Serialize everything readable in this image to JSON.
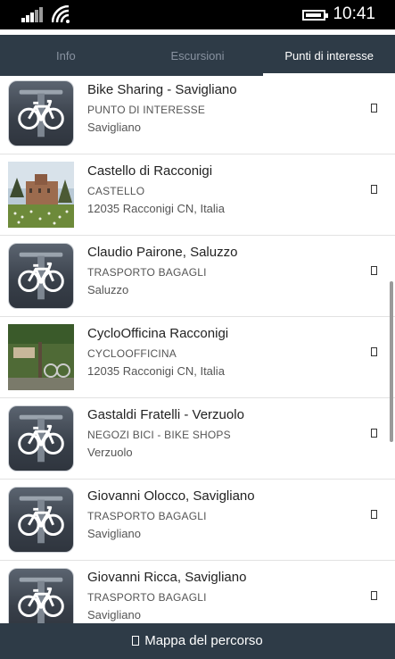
{
  "status": {
    "time": "10:41"
  },
  "tabs": [
    {
      "label": "Info"
    },
    {
      "label": "Escursioni"
    },
    {
      "label": "Punti di interesse"
    }
  ],
  "items": [
    {
      "title": "Bike Sharing - Savigliano",
      "category": "PUNTO DI INTERESSE",
      "location": "Savigliano",
      "thumb": "bike-icon"
    },
    {
      "title": "Castello di Racconigi",
      "category": "CASTELLO",
      "location": "12035 Racconigi CN, Italia",
      "thumb": "castle-photo"
    },
    {
      "title": "Claudio Pairone, Saluzzo",
      "category": "TRASPORTO BAGAGLI",
      "location": "Saluzzo",
      "thumb": "bike-icon"
    },
    {
      "title": "CycloOfficina Racconigi",
      "category": "CYCLOOFFICINA",
      "location": "12035 Racconigi CN, Italia",
      "thumb": "bikeshop-photo"
    },
    {
      "title": "Gastaldi Fratelli - Verzuolo",
      "category": "NEGOZI BICI - BIKE SHOPS",
      "location": "Verzuolo",
      "thumb": "bike-icon"
    },
    {
      "title": "Giovanni Olocco, Savigliano",
      "category": "TRASPORTO BAGAGLI",
      "location": "Savigliano",
      "thumb": "bike-icon"
    },
    {
      "title": "Giovanni Ricca, Savigliano",
      "category": "TRASPORTO BAGAGLI",
      "location": "Savigliano",
      "thumb": "bike-icon"
    }
  ],
  "bottom_bar": {
    "label": "Mappa del percorso"
  }
}
